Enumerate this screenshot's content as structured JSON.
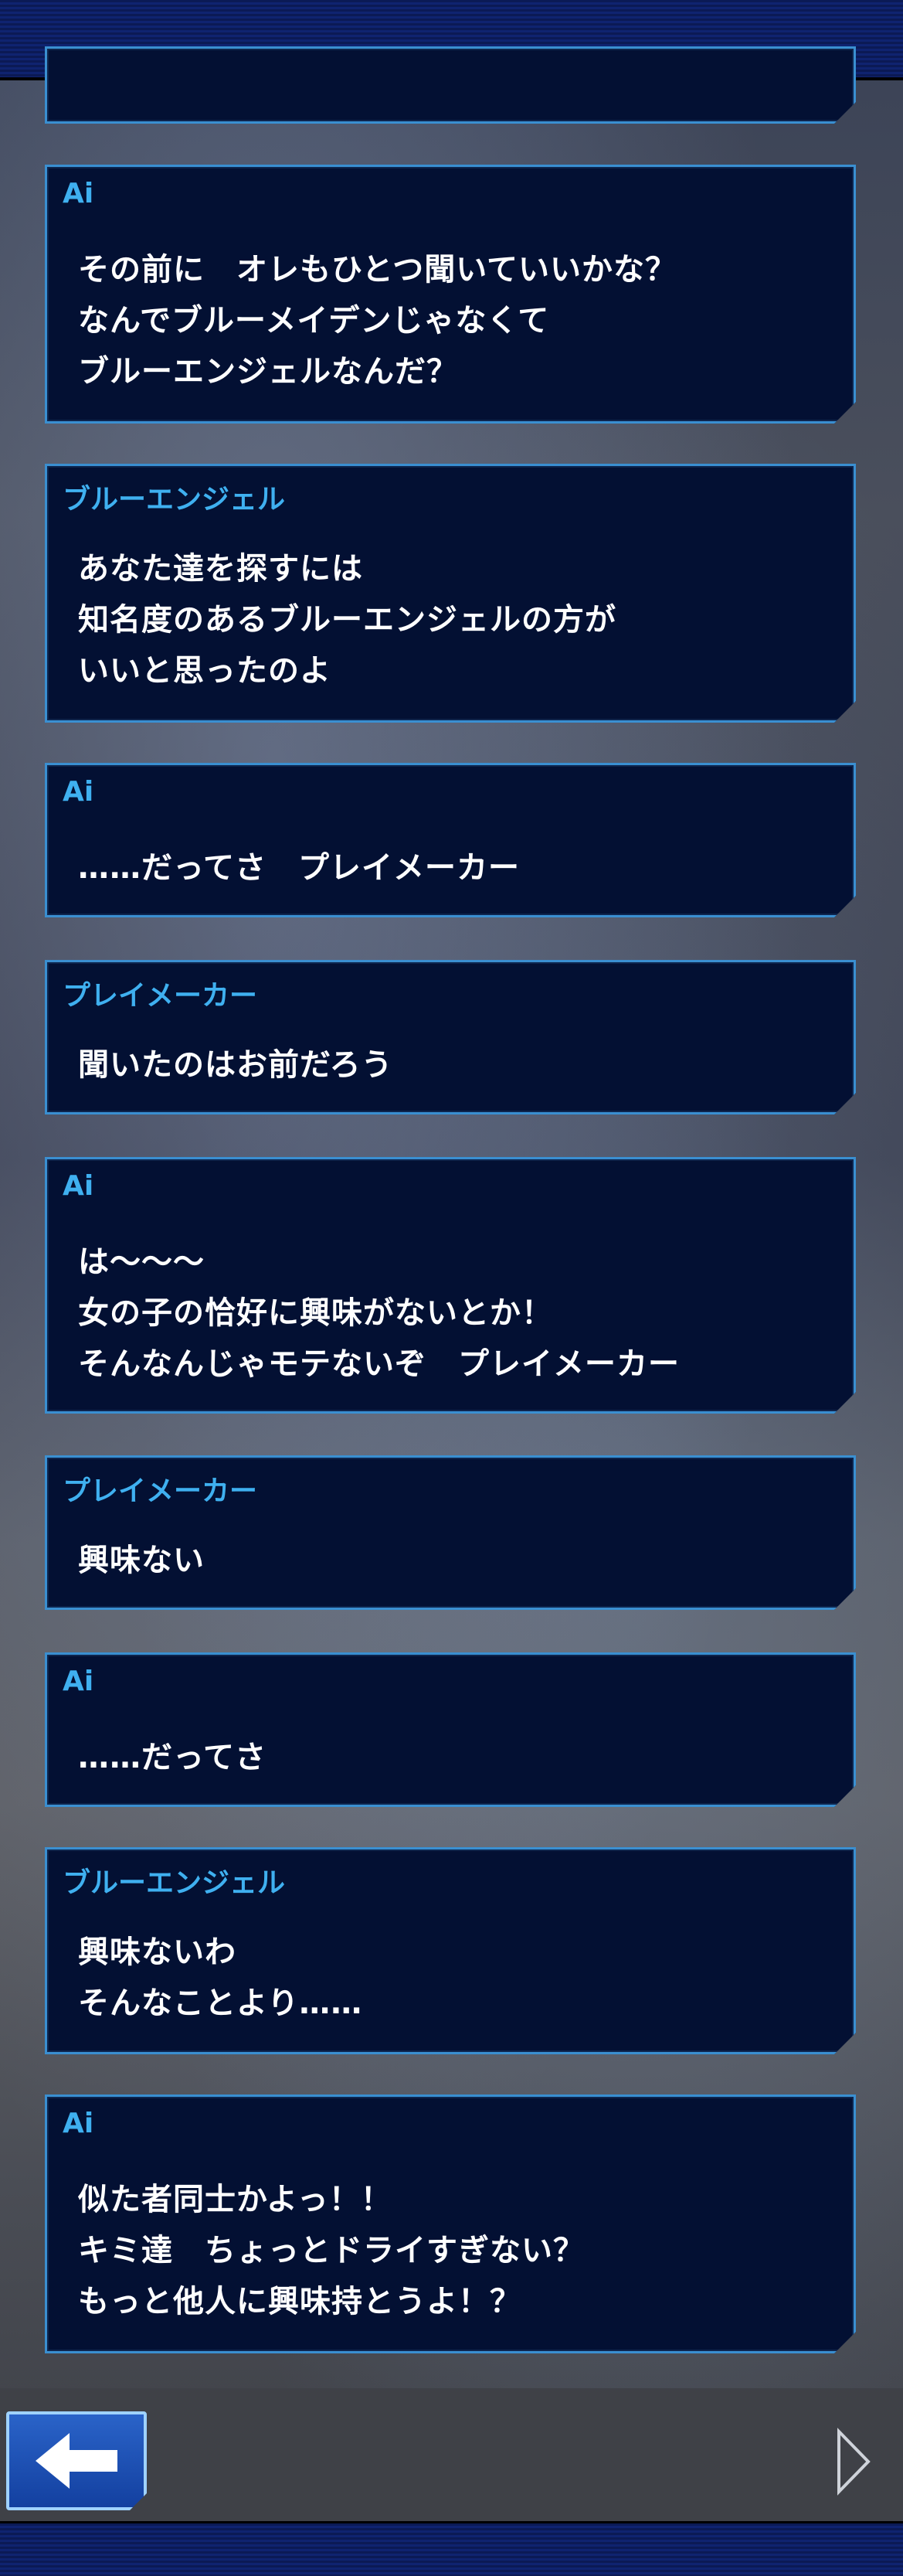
{
  "dialogue": [
    {
      "speaker": "Ai",
      "lines": [
        "その前に　オレもひとつ聞いていいかな？",
        "なんでブルーメイデンじゃなくて",
        "ブルーエンジェルなんだ？"
      ]
    },
    {
      "speaker": "ブルーエンジェル",
      "lines": [
        "あなた達を探すには",
        "知名度のあるブルーエンジェルの方が",
        "いいと思ったのよ"
      ]
    },
    {
      "speaker": "Ai",
      "lines": [
        "……だってさ　プレイメーカー"
      ]
    },
    {
      "speaker": "プレイメーカー",
      "lines": [
        "聞いたのはお前だろう"
      ]
    },
    {
      "speaker": "Ai",
      "lines": [
        "は〜〜〜",
        "女の子の恰好に興味がないとか！",
        "そんなんじゃモテないぞ　プレイメーカー"
      ]
    },
    {
      "speaker": "プレイメーカー",
      "lines": [
        "興味ない"
      ]
    },
    {
      "speaker": "Ai",
      "lines": [
        "……だってさ"
      ]
    },
    {
      "speaker": "ブルーエンジェル",
      "lines": [
        "興味ないわ",
        "そんなことより……"
      ]
    },
    {
      "speaker": "Ai",
      "lines": [
        "似た者同士かよっ！！",
        "キミ達　ちょっとドライすぎない？",
        "もっと他人に興味持とうよ！？"
      ]
    }
  ],
  "colors": {
    "bubble_bg": "#031033",
    "bubble_border": "#3a8fd1",
    "speaker_name": "#3fb0f0",
    "text": "#ffffff"
  },
  "icons": {
    "back": "left-arrow-icon",
    "next": "play-triangle-icon"
  }
}
